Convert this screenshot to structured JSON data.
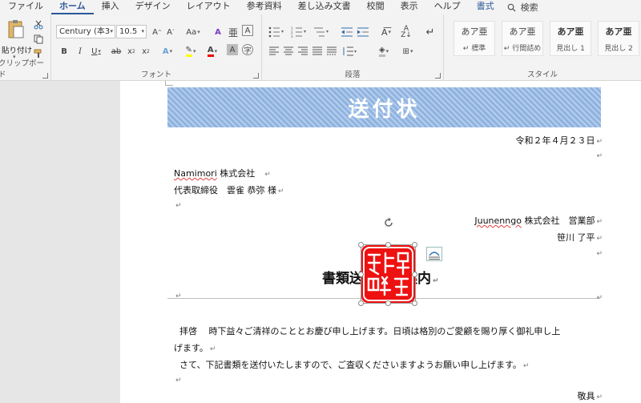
{
  "menubar": {
    "items": [
      "ファイル",
      "ホーム",
      "挿入",
      "デザイン",
      "レイアウト",
      "参考資料",
      "差し込み文書",
      "校閲",
      "表示",
      "ヘルプ",
      "書式"
    ],
    "search": "検索"
  },
  "ribbon": {
    "clipboard": {
      "paste": "貼り付け",
      "label": "クリップボード"
    },
    "font": {
      "name": "Century (本3",
      "size": "10.5",
      "label": "フォント"
    },
    "paragraph": {
      "label": "段落"
    },
    "styles": {
      "label": "スタイル",
      "tiles": [
        {
          "sample": "あア亜",
          "name": "↵ 標準"
        },
        {
          "sample": "あア亜",
          "name": "↵ 行間詰め"
        },
        {
          "sample": "あア亜",
          "name": "見出し 1"
        },
        {
          "sample": "あア亜",
          "name": "見出し 2"
        }
      ]
    }
  },
  "document": {
    "banner": "送付状",
    "date": "令和２年４月２３日",
    "recipient_company": "Namimori",
    "recipient_company_suffix": " 株式会社",
    "recipient_person": "代表取締役　雲雀 恭弥 様",
    "sender_company": "Juunenngo",
    "sender_company_suffix": " 株式会社　営業部",
    "sender_person": "笹川 了平",
    "subject": "書類送付のご案内",
    "para1_line1": "拝啓　 時下益々ご清祥のこととお慶び申し上げます。日頃は格別のご愛顧を賜り厚く御礼申し上",
    "para1_line2": "げます。",
    "para2": "さて、下記書類を送付いたしますので、ご査収くださいますようお願い申し上げます。",
    "closing": "敬具"
  }
}
